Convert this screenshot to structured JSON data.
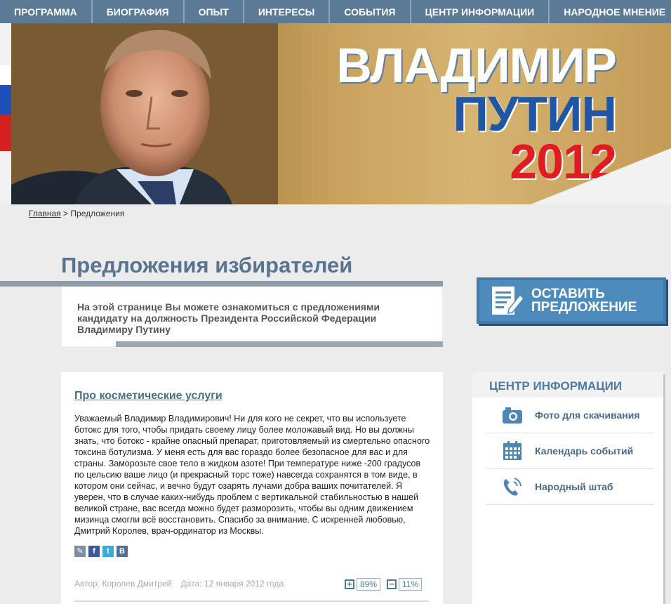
{
  "nav": {
    "items": [
      "ПРОГРАММА",
      "БИОГРАФИЯ",
      "ОПЫТ",
      "ИНТЕРЕСЫ",
      "СОБЫТИЯ",
      "ЦЕНТР ИНФОРМАЦИИ",
      "НАРОДНОЕ МНЕНИЕ"
    ]
  },
  "banner": {
    "line1": "ВЛАДИМИР",
    "line2": "ПУТИН",
    "line3": "2012",
    "colors": {
      "line1": "#ffffff",
      "line2": "#1f57a6",
      "line3": "#e11b22"
    }
  },
  "breadcrumb": {
    "home": "Главная",
    "separator": ">",
    "current": "Предложения"
  },
  "page": {
    "title": "Предложения избирателей",
    "intro": "На этой странице Вы можете ознакомиться с предложениями кандидату на должность Президента Российской Федерации Владимиру Путину"
  },
  "leave_proposal": {
    "line1": "ОСТАВИТЬ",
    "line2": "ПРЕДЛОЖЕНИЕ",
    "icon": "document-pen-icon"
  },
  "info_center": {
    "title": "ЦЕНТР ИНФОРМАЦИИ",
    "items": [
      {
        "label": "Фото для скачивания",
        "icon": "camera-icon"
      },
      {
        "label": "Календарь событий",
        "icon": "calendar-icon"
      },
      {
        "label": "Народный штаб",
        "icon": "phone-icon"
      }
    ]
  },
  "proposal": {
    "title": "Про косметические услуги",
    "body": "Уважаемый Владимир Владимирович! Ни для кого не секрет, что вы используете ботокс для того, чтобы придать своему лицу более моложавый вид. Но вы должны знать, что ботокс - крайне опасный препарат, приготовляемый из смертельно опасного токсина ботулизма. У меня есть для вас гораздо более безопасное для вас и для страны. Заморозьте свое тело в жидком азоте! При температуре ниже -200 градусов по цельсию ваше лицо (и прекрасный торс тоже) навсегда сохранятся в том виде, в котором они сейчас, и вечно будут озарять лучами добра ваших почитателей. Я уверен, что в случае каких-нибудь проблем с вертикальной стабильностью в нашей великой стране, вас всегда можно будет разморозить, чтобы вы одним движением мизинца смогли всё восстановить. Спасибо за внимание. С искренней любовью, Дмитрий Королев, врач-ординатор из Москвы.",
    "share": [
      {
        "icon": "edit-icon",
        "glyph": "✎",
        "color": "#7a8fa3"
      },
      {
        "icon": "facebook-icon",
        "glyph": "f",
        "color": "#3b5998"
      },
      {
        "icon": "twitter-icon",
        "glyph": "t",
        "color": "#3aa9df"
      },
      {
        "icon": "vkontakte-icon",
        "glyph": "B",
        "color": "#4f6f95"
      }
    ],
    "author_label": "Автор:",
    "author": "Королев Дмитрий",
    "date_label": "Дата:",
    "date": "12 января 2012 года",
    "votes": {
      "plus_icon": "plus-icon",
      "plus_pct": "89%",
      "minus_icon": "minus-icon",
      "minus_pct": "11%"
    }
  }
}
